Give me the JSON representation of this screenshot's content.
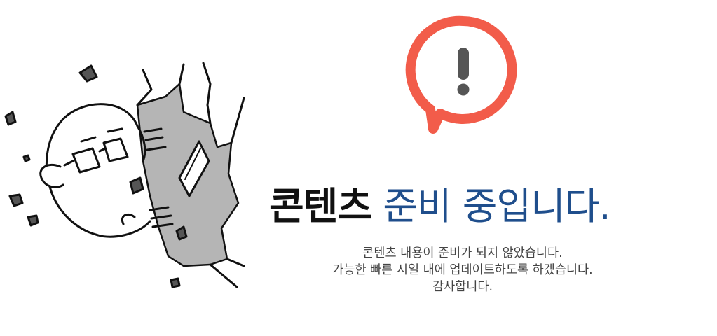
{
  "headline": {
    "strong": "콘텐츠",
    "accent": "준비 중입니다."
  },
  "message": {
    "lines": [
      "콘텐츠 내용이 준비가 되지 않았습니다.",
      "가능한 빠른 시일 내에 업데이트하도록 하겠습니다.",
      "감사합니다."
    ]
  },
  "icons": {
    "alert": "exclamation-speech-bubble-icon",
    "illustration": "crashing-character-illustration"
  },
  "colors": {
    "alert_ring": "#f25c4a",
    "alert_mark": "#555555",
    "headline_strong": "#111111",
    "headline_accent": "#1f4e8c",
    "body_text": "#444444",
    "crack_fill": "#b5b5b5"
  }
}
